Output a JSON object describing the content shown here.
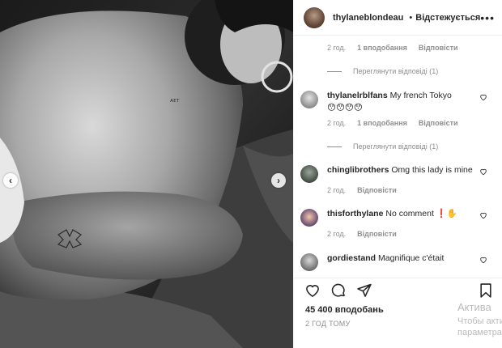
{
  "post": {
    "username": "thylaneblondeau",
    "follow_status": "Відстежується",
    "dot": "•"
  },
  "comments": {
    "first_meta": {
      "time": "2 год.",
      "likes": "1 вподобання",
      "reply": "Відповісти"
    },
    "first_view_replies": "Переглянути відповіді (1)",
    "items": [
      {
        "username": "thylanelrblfans",
        "text": "My french Tokyo",
        "emoji": "😯😯😯😯",
        "time": "2 год.",
        "likes": "1 вподобання",
        "reply": "Відповісти",
        "view_replies": "Переглянути відповіді (1)"
      },
      {
        "username": "chinglibrothers",
        "text": "Omg this lady is mine",
        "time": "2 год.",
        "reply": "Відповісти"
      },
      {
        "username": "thisforthylane",
        "text": "No comment",
        "emoji": "❗✋",
        "time": "2 год.",
        "reply": "Відповісти"
      },
      {
        "username": "gordiestand",
        "text": "Magnifique c'était"
      }
    ]
  },
  "actions": {
    "likes_count": "45 400 вподобань",
    "time_ago": "2 ГОД ТОМУ"
  },
  "watermark": {
    "line1": "Актива",
    "line2": "Чтобы акти",
    "line3": "параметра"
  },
  "colors": {
    "verified": "#3897f0",
    "secondary_text": "#8e8e8e",
    "primary_text": "#262626"
  },
  "icons": [
    "chevron-left-icon",
    "chevron-right-icon",
    "verified-badge-icon",
    "more-icon",
    "heart-icon",
    "comment-icon",
    "share-icon",
    "bookmark-icon"
  ]
}
